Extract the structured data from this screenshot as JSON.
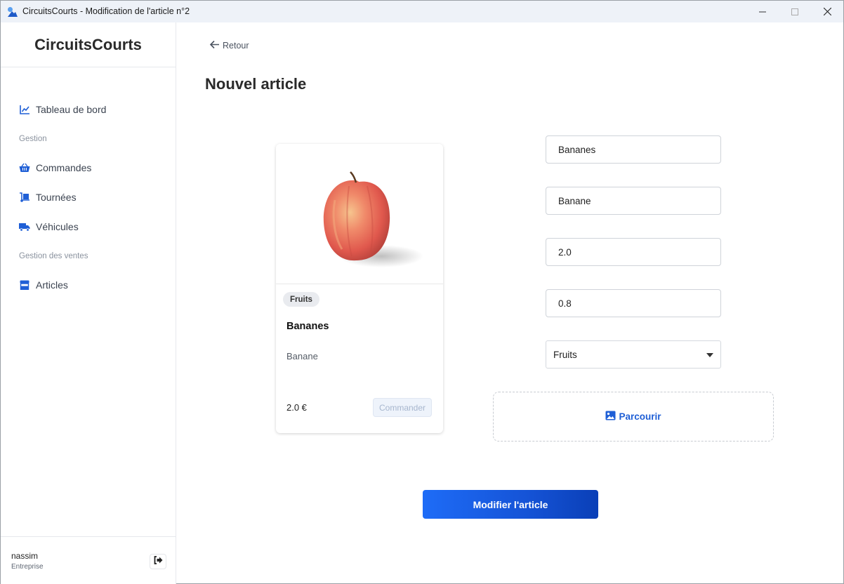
{
  "window": {
    "title": "CircuitsCourts - Modification de l'article n°2"
  },
  "sidebar": {
    "brand": "CircuitsCourts",
    "dashboard": "Tableau de bord",
    "section_gestion": "Gestion",
    "orders": "Commandes",
    "rounds": "Tournées",
    "vehicles": "Véhicules",
    "section_sales": "Gestion des ventes",
    "articles": "Articles",
    "user": {
      "name": "nassim",
      "role": "Entreprise"
    }
  },
  "main": {
    "back_label": "Retour",
    "page_title": "Nouvel article"
  },
  "preview_card": {
    "category_badge": "Fruits",
    "title": "Bananes",
    "description": "Banane",
    "price": "2.0 €",
    "order_button": "Commander"
  },
  "form": {
    "name_value": "Bananes",
    "description_value": "Banane",
    "price_value": "2.0",
    "quantity_value": "0.8",
    "category_selected": "Fruits",
    "browse_label": "Parcourir",
    "submit_label": "Modifier l'article"
  },
  "colors": {
    "accent": "#1f5fd6",
    "button_gradient_start": "#1e6cf7",
    "button_gradient_end": "#0a3fb7"
  }
}
